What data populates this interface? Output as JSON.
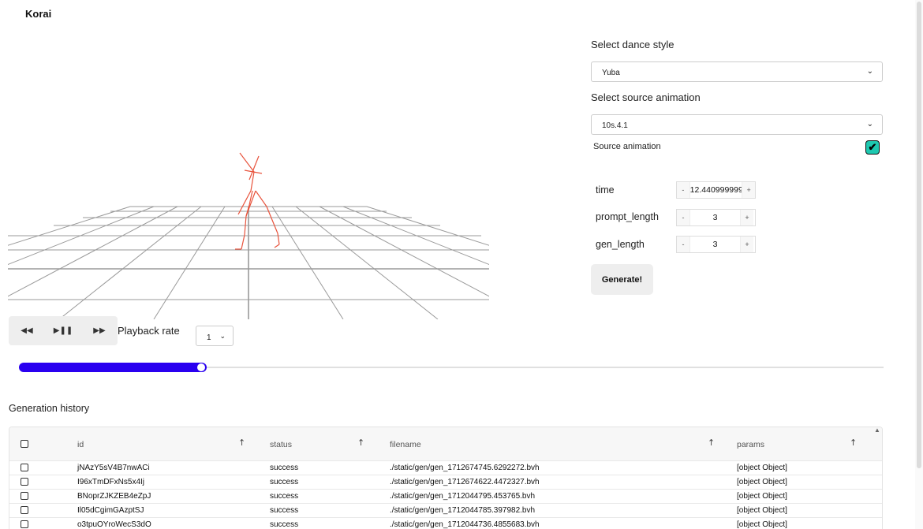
{
  "app": {
    "title": "Korai"
  },
  "viewer": {
    "controls": {
      "rewind": "◀◀",
      "play_pause": "▶❚❚",
      "forward": "▶▶"
    },
    "playback_rate_label": "Playback rate",
    "playback_rate_value": "1",
    "progress_fraction": 0.215,
    "figure_color": "#e8533c",
    "grid_color": "#9a9a9a"
  },
  "settings": {
    "dance_style_label": "Select dance style",
    "dance_style_value": "Yuba",
    "source_animation_label": "Select source animation",
    "source_animation_value": "10s.4.1",
    "source_animation_checkbox_label": "Source animation",
    "source_animation_checked": true,
    "params": [
      {
        "name": "time",
        "value": "12.440999999",
        "minus": "-",
        "plus": "+"
      },
      {
        "name": "prompt_length",
        "value": "3",
        "minus": "-",
        "plus": "+"
      },
      {
        "name": "gen_length",
        "value": "3",
        "minus": "-",
        "plus": "+"
      }
    ],
    "generate_label": "Generate!"
  },
  "history": {
    "title": "Generation history",
    "columns": [
      "id",
      "status",
      "filename",
      "params"
    ],
    "rows": [
      {
        "id": "jNAzY5sV4B7nwACi",
        "status": "success",
        "filename": "./static/gen/gen_1712674745.6292272.bvh",
        "params": "[object Object]"
      },
      {
        "id": "I96xTmDFxNs5x4Ij",
        "status": "success",
        "filename": "./static/gen/gen_1712674622.4472327.bvh",
        "params": "[object Object]"
      },
      {
        "id": "BNoprZJKZEB4eZpJ",
        "status": "success",
        "filename": "./static/gen/gen_1712044795.453765.bvh",
        "params": "[object Object]"
      },
      {
        "id": "Il05dCgimGAzptSJ",
        "status": "success",
        "filename": "./static/gen/gen_1712044785.397982.bvh",
        "params": "[object Object]"
      },
      {
        "id": "o3tpuOYroWecS3dO",
        "status": "success",
        "filename": "./static/gen/gen_1712044736.4855683.bvh",
        "params": "[object Object]"
      }
    ]
  },
  "colors": {
    "accent": "#2a00f0",
    "checkbox": "#1ec8b0"
  }
}
